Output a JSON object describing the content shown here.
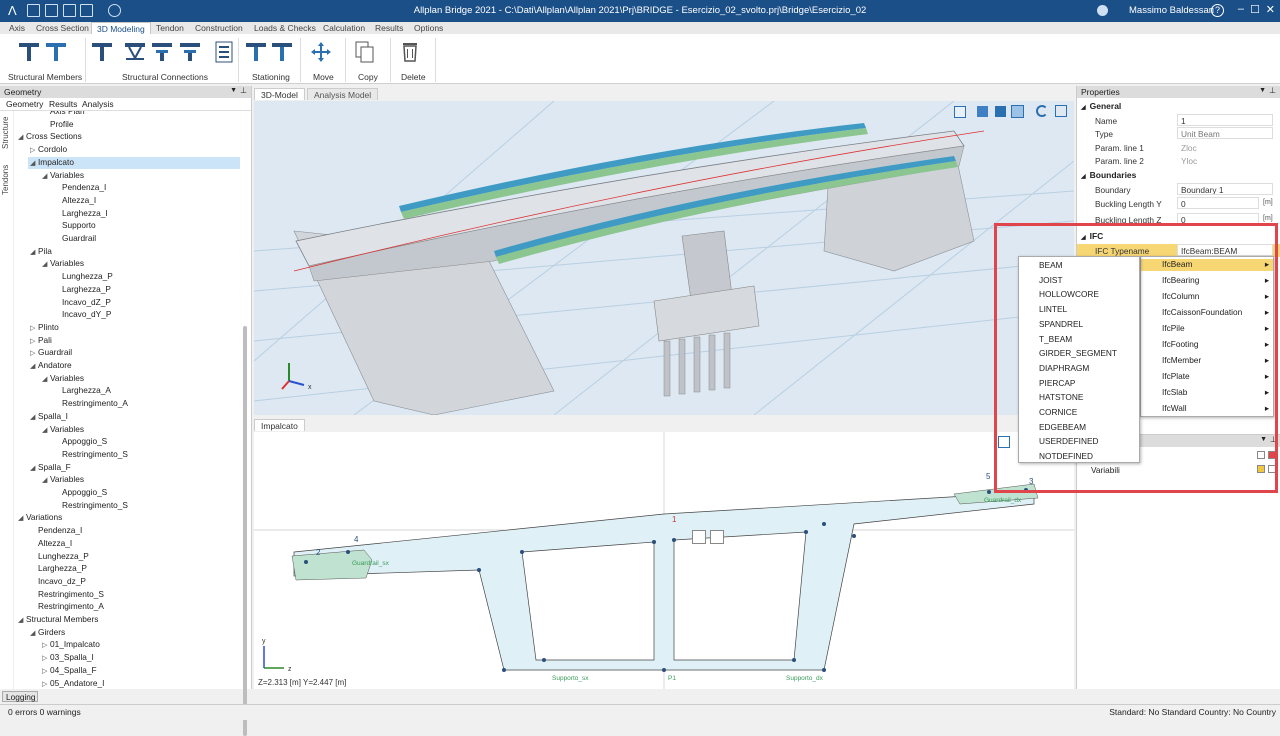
{
  "titlebar": {
    "title": "Allplan Bridge 2021 - C:\\Dati\\Allplan\\Allplan 2021\\Prj\\BRIDGE - Esercizio_02_svolto.prj\\Bridge\\Esercizio_02",
    "user": "Massimo Baldessari",
    "help_glyph": "?",
    "minimize_glyph": "–",
    "maximize_glyph": "☐",
    "close_glyph": "✕"
  },
  "ribbon_tabs": [
    "Axis",
    "Cross Section",
    "3D Modeling",
    "Tendon",
    "Construction",
    "Loads & Checks",
    "Calculation",
    "Results",
    "Options"
  ],
  "ribbon_groups": {
    "structural_members": "Structural Members",
    "structural_connections": "Structural Connections",
    "stationing": "Stationing",
    "move": "Move",
    "copy": "Copy",
    "delete": "Delete"
  },
  "left_panel": {
    "title": "Geometry",
    "subtabs": [
      "Geometry",
      "Results",
      "Analysis"
    ],
    "vertical_tabs": [
      "Structure",
      "Tendons"
    ],
    "pin_glyph": "⊥"
  },
  "tree": [
    {
      "label": "Axis Plan",
      "level": 3,
      "toggle": ""
    },
    {
      "label": "Profile",
      "level": 3,
      "toggle": ""
    },
    {
      "label": "Cross Sections",
      "level": 1,
      "toggle": "◢"
    },
    {
      "label": "Cordolo",
      "level": 2,
      "toggle": "▷"
    },
    {
      "label": "Impalcato",
      "level": 2,
      "toggle": "◢",
      "selected": true
    },
    {
      "label": "Variables",
      "level": 3,
      "toggle": "◢"
    },
    {
      "label": "Pendenza_I",
      "level": 4,
      "toggle": ""
    },
    {
      "label": "Altezza_I",
      "level": 4,
      "toggle": ""
    },
    {
      "label": "Larghezza_I",
      "level": 4,
      "toggle": ""
    },
    {
      "label": "Supporto",
      "level": 4,
      "toggle": ""
    },
    {
      "label": "Guardrail",
      "level": 4,
      "toggle": ""
    },
    {
      "label": "Pila",
      "level": 2,
      "toggle": "◢"
    },
    {
      "label": "Variables",
      "level": 3,
      "toggle": "◢"
    },
    {
      "label": "Lunghezza_P",
      "level": 4,
      "toggle": ""
    },
    {
      "label": "Larghezza_P",
      "level": 4,
      "toggle": ""
    },
    {
      "label": "Incavo_dZ_P",
      "level": 4,
      "toggle": ""
    },
    {
      "label": "Incavo_dY_P",
      "level": 4,
      "toggle": ""
    },
    {
      "label": "Plinto",
      "level": 2,
      "toggle": "▷"
    },
    {
      "label": "Pali",
      "level": 2,
      "toggle": "▷"
    },
    {
      "label": "Guardrail",
      "level": 2,
      "toggle": "▷"
    },
    {
      "label": "Andatore",
      "level": 2,
      "toggle": "◢"
    },
    {
      "label": "Variables",
      "level": 3,
      "toggle": "◢"
    },
    {
      "label": "Larghezza_A",
      "level": 4,
      "toggle": ""
    },
    {
      "label": "Restringimento_A",
      "level": 4,
      "toggle": ""
    },
    {
      "label": "Spalla_I",
      "level": 2,
      "toggle": "◢"
    },
    {
      "label": "Variables",
      "level": 3,
      "toggle": "◢"
    },
    {
      "label": "Appoggio_S",
      "level": 4,
      "toggle": ""
    },
    {
      "label": "Restringimento_S",
      "level": 4,
      "toggle": ""
    },
    {
      "label": "Spalla_F",
      "level": 2,
      "toggle": "◢"
    },
    {
      "label": "Variables",
      "level": 3,
      "toggle": "◢"
    },
    {
      "label": "Appoggio_S",
      "level": 4,
      "toggle": ""
    },
    {
      "label": "Restringimento_S",
      "level": 4,
      "toggle": ""
    },
    {
      "label": "Variations",
      "level": 1,
      "toggle": "◢"
    },
    {
      "label": "Pendenza_I",
      "level": 2,
      "toggle": ""
    },
    {
      "label": "Altezza_I",
      "level": 2,
      "toggle": ""
    },
    {
      "label": "Lunghezza_P",
      "level": 2,
      "toggle": ""
    },
    {
      "label": "Larghezza_P",
      "level": 2,
      "toggle": ""
    },
    {
      "label": "Incavo_dz_P",
      "level": 2,
      "toggle": ""
    },
    {
      "label": "Restringimento_S",
      "level": 2,
      "toggle": ""
    },
    {
      "label": "Restringimento_A",
      "level": 2,
      "toggle": ""
    },
    {
      "label": "Structural Members",
      "level": 1,
      "toggle": "◢"
    },
    {
      "label": "Girders",
      "level": 2,
      "toggle": "◢"
    },
    {
      "label": "01_Impalcato",
      "level": 3,
      "toggle": "▷"
    },
    {
      "label": "03_Spalla_I",
      "level": 3,
      "toggle": "▷"
    },
    {
      "label": "04_Spalla_F",
      "level": 3,
      "toggle": "▷"
    },
    {
      "label": "05_Andatore_I",
      "level": 3,
      "toggle": "▷"
    }
  ],
  "viewport": {
    "tabs": [
      "3D-Model",
      "Analysis Model"
    ],
    "section_tab": "Impalcato",
    "coords": "Z=2.313 [m] Y=2.447 [m]",
    "section_labels": {
      "n1": "1",
      "n2": "2",
      "n3": "3",
      "n4": "4",
      "n5": "5",
      "guardrail_sx": "Guardrail_sx",
      "guardrail_dx": "Guardrail_dx",
      "supporto_sx": "Supporto_sx",
      "supporto_dx": "Supporto_dx",
      "p1": "P1"
    },
    "axes": {
      "y": "y",
      "z": "z",
      "x3d": "x"
    }
  },
  "properties": {
    "title": "Properties",
    "general": "General",
    "name_label": "Name",
    "name_value": "1",
    "type_label": "Type",
    "type_value": "Unit Beam",
    "param1_label": "Param. line 1",
    "param1_value": "Zloc",
    "param2_label": "Param. line 2",
    "param2_value": "Yloc",
    "boundaries": "Boundaries",
    "boundary_label": "Boundary",
    "boundary_value": "Boundary 1",
    "bly_label": "Buckling Length Y",
    "bly_value": "0",
    "bly_unit": "[m]",
    "blz_label": "Buckling Length Z",
    "blz_value": "0",
    "blz_unit": "[m]",
    "ifc": "IFC",
    "ifc_type_label": "IFC Typename",
    "ifc_type_value": "IfcBeam:BEAM",
    "sub_panel_item": "Variabili",
    "expand_glyph": "◢",
    "arrow_glyph": "▸"
  },
  "ifc_menu": [
    {
      "label": "IfcBeam",
      "highlight": true
    },
    {
      "label": "IfcBearing"
    },
    {
      "label": "IfcColumn"
    },
    {
      "label": "IfcCaissonFoundation"
    },
    {
      "label": "IfcPile"
    },
    {
      "label": "IfcFooting"
    },
    {
      "label": "IfcMember"
    },
    {
      "label": "IfcPlate"
    },
    {
      "label": "IfcSlab"
    },
    {
      "label": "IfcWall"
    }
  ],
  "beam_menu": [
    "BEAM",
    "JOIST",
    "HOLLOWCORE",
    "LINTEL",
    "SPANDREL",
    "T_BEAM",
    "GIRDER_SEGMENT",
    "DIAPHRAGM",
    "PIERCAP",
    "HATSTONE",
    "CORNICE",
    "EDGEBEAM",
    "USERDEFINED",
    "NOTDEFINED"
  ],
  "bottom": {
    "logging": "Logging",
    "status": "0 errors 0 warnings",
    "standard": "Standard: No Standard Country: No Country"
  },
  "colors": {
    "title_bar": "#1b4f88",
    "selection": "#cce4f7",
    "highlight_box": "#e0454c",
    "menu_highlight": "#f7d774",
    "section_fill": "#dff1f7"
  }
}
